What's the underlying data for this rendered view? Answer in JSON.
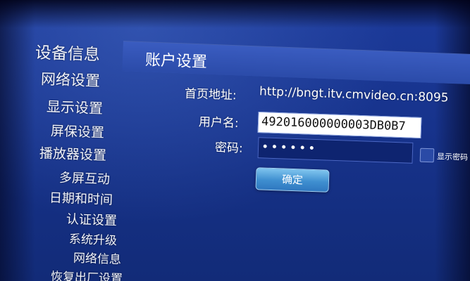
{
  "sidebar": {
    "items": [
      {
        "label": "设备信息"
      },
      {
        "label": "网络设置"
      },
      {
        "label": "显示设置"
      },
      {
        "label": "屏保设置"
      },
      {
        "label": "播放器设置"
      },
      {
        "label": "多屏互动"
      },
      {
        "label": "日期和时间"
      },
      {
        "label": "认证设置"
      },
      {
        "label": "系统升级"
      },
      {
        "label": "网络信息"
      },
      {
        "label": "恢复出厂设置"
      }
    ]
  },
  "panel": {
    "title": "账户设置",
    "homepage_label": "首页地址:",
    "homepage_value": "http://bngt.itv.cmvideo.cn:8095",
    "username_label": "用户名:",
    "username_value": "492016000000003DB0B7",
    "password_label": "密码:",
    "password_value": "••••••",
    "show_password_label": "显示密码",
    "show_password_checked": false,
    "confirm_label": "确定"
  },
  "colors": {
    "background": "#17338c",
    "header_panel": "#3a5cc0",
    "button": "#3f8fd0"
  }
}
